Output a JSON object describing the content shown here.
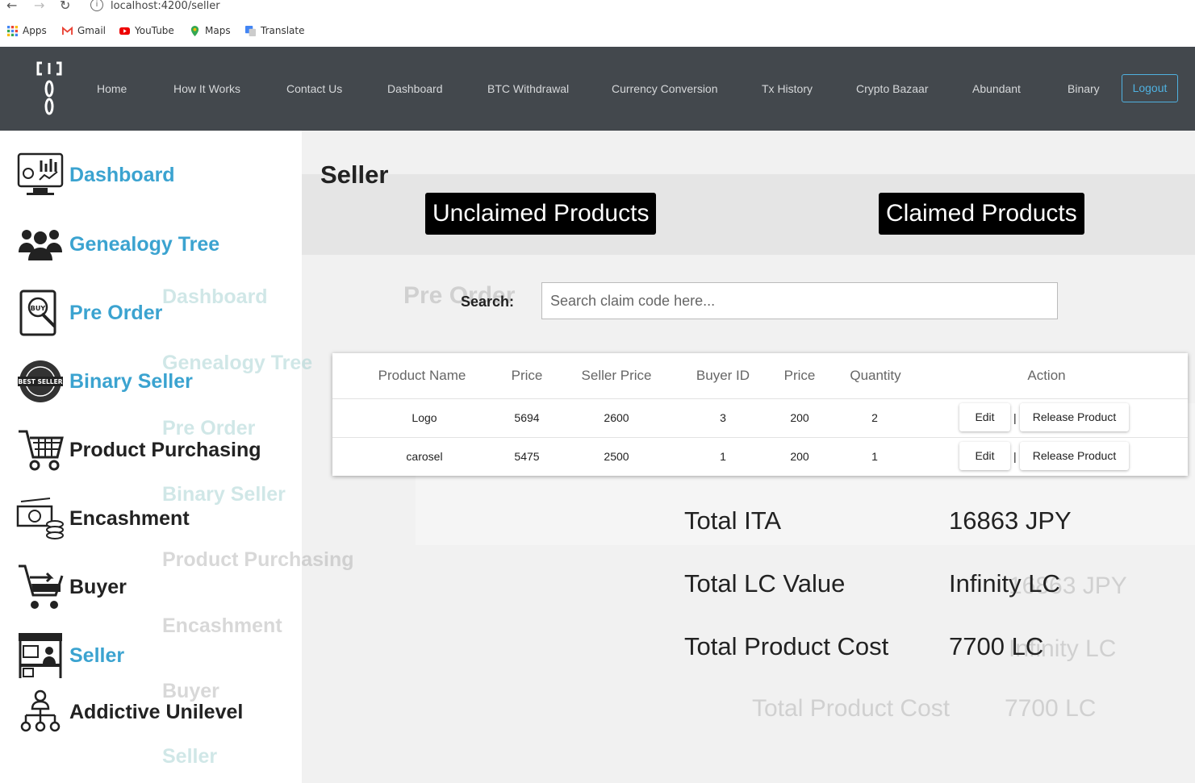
{
  "browser": {
    "url": "localhost:4200/seller",
    "bookmarks": [
      "Apps",
      "Gmail",
      "YouTube",
      "Maps",
      "Translate"
    ]
  },
  "navbar": {
    "links": [
      "Home",
      "How It Works",
      "Contact Us",
      "Dashboard",
      "BTC Withdrawal",
      "Currency Conversion",
      "Tx History",
      "Crypto Bazaar",
      "Abundant",
      "Binary"
    ],
    "logout": "Logout"
  },
  "sidebar": {
    "items": [
      {
        "label": "Dashboard",
        "icon": "dashboard-monitor-icon"
      },
      {
        "label": "Genealogy Tree",
        "icon": "people-group-icon"
      },
      {
        "label": "Pre Order",
        "icon": "buy-tablet-icon"
      },
      {
        "label": "Binary Seller",
        "icon": "best-seller-badge-icon"
      },
      {
        "label": "Product Purchasing",
        "icon": "shopping-cart-icon"
      },
      {
        "label": "Encashment",
        "icon": "cash-coins-icon"
      },
      {
        "label": "Buyer",
        "icon": "cart-arrow-icon"
      },
      {
        "label": "Seller",
        "icon": "market-stall-icon"
      },
      {
        "label": "Addictive Unilevel",
        "icon": "hierarchy-icon"
      }
    ]
  },
  "main": {
    "title": "Seller",
    "tabs": [
      "Unclaimed Products",
      "Claimed Products"
    ],
    "search": {
      "label": "Search:",
      "placeholder": "Search claim code here..."
    },
    "table": {
      "headers": [
        "Product Name",
        "Price",
        "Seller Price",
        "Buyer ID",
        "Price",
        "Quantity",
        "Action"
      ],
      "rows": [
        {
          "product": "Logo",
          "price": "5694",
          "seller_price": "2600",
          "buyer_id": "3",
          "price2": "200",
          "quantity": "2"
        },
        {
          "product": "carosel",
          "price": "5475",
          "seller_price": "2500",
          "buyer_id": "1",
          "price2": "200",
          "quantity": "1"
        }
      ],
      "edit_label": "Edit",
      "release_label": "Release Product",
      "separator": "|"
    },
    "summary": [
      {
        "label": "Total ITA",
        "value": "16863 JPY"
      },
      {
        "label": "Total LC Value",
        "value": "Infinity LC"
      },
      {
        "label": "Total Product Cost",
        "value": "7700 LC"
      }
    ]
  },
  "ghost_overlay": {
    "title": "Pre Order",
    "sidebar": [
      "Dashboard",
      "Genealogy Tree",
      "Pre Order",
      "Binary Seller",
      "Product Purchasing",
      "Encashment",
      "Buyer",
      "Seller"
    ],
    "summary_values": [
      "16863 JPY",
      "Infinity LC",
      "7700 LC"
    ],
    "summary_label": "Total Product Cost"
  },
  "colors": {
    "navbar_bg": "#43484d",
    "sidebar_active": "#3ba3d0",
    "logout_border": "#4fb1e0",
    "tab_bg": "#000000"
  }
}
